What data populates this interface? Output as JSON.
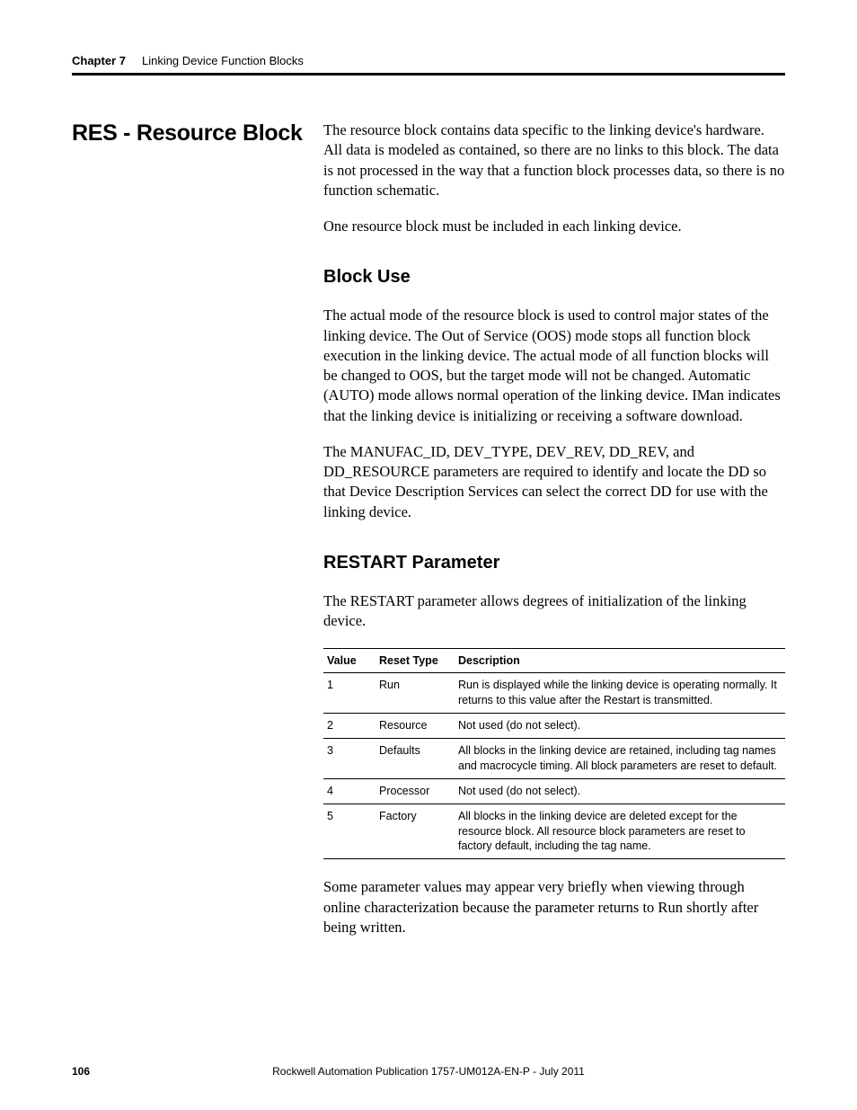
{
  "header": {
    "chapter_label": "Chapter 7",
    "chapter_title": "Linking Device Function Blocks"
  },
  "section": {
    "title": "RES - Resource Block",
    "intro_p1": "The resource block contains data specific to the linking device's hardware. All data is modeled as contained, so there are no links to this block. The data is not processed in the way that a function block processes data, so there is no function schematic.",
    "intro_p2": "One resource block must be included in each linking device."
  },
  "block_use": {
    "heading": "Block Use",
    "p1": "The actual mode of the resource block is used to control major states of the linking device. The Out of Service (OOS) mode stops all function block execution in the linking device. The actual mode of all function blocks will be changed to OOS, but the target mode will not be changed. Automatic (AUTO) mode allows normal operation of the linking device. IMan indicates that the linking device is initializing or receiving a software download.",
    "p2": "The MANUFAC_ID, DEV_TYPE, DEV_REV, DD_REV, and DD_RESOURCE parameters are required to identify and locate the DD so that Device Description Services can select the correct DD for use with the linking device."
  },
  "restart": {
    "heading": "RESTART Parameter",
    "intro": "The RESTART parameter allows degrees of initialization of the linking device.",
    "table": {
      "headers": [
        "Value",
        "Reset Type",
        "Description"
      ],
      "rows": [
        {
          "value": "1",
          "reset_type": "Run",
          "description": "Run is displayed while the linking device is operating normally. It returns to this value after the Restart is transmitted."
        },
        {
          "value": "2",
          "reset_type": "Resource",
          "description": "Not used (do not select)."
        },
        {
          "value": "3",
          "reset_type": "Defaults",
          "description": "All blocks in the linking device are retained, including tag names and macrocycle timing. All block parameters are reset to default."
        },
        {
          "value": "4",
          "reset_type": "Processor",
          "description": "Not used (do not select)."
        },
        {
          "value": "5",
          "reset_type": "Factory",
          "description": "All blocks in the linking device are deleted except for the resource block. All resource block parameters are reset to factory default, including the tag name."
        }
      ]
    },
    "outro": "Some parameter values may appear very briefly when viewing through online characterization because the parameter returns to Run shortly after being written."
  },
  "footer": {
    "page_number": "106",
    "publication": "Rockwell Automation Publication 1757-UM012A-EN-P - July 2011"
  }
}
